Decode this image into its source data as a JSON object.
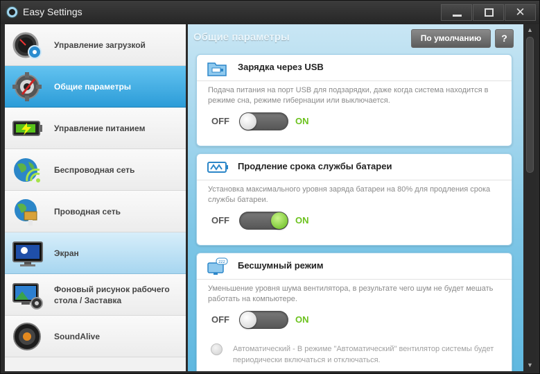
{
  "window": {
    "title": "Easy Settings",
    "minimize_icon": "minimize-icon",
    "maximize_icon": "maximize-icon",
    "close_glyph": "✕"
  },
  "sidebar": {
    "items": [
      {
        "label": "Управление загрузкой",
        "icon": "speedometer-icon",
        "state": "normal"
      },
      {
        "label": "Общие параметры",
        "icon": "gear-icon",
        "state": "active"
      },
      {
        "label": "Управление питанием",
        "icon": "battery-icon",
        "state": "normal"
      },
      {
        "label": "Беспроводная сеть",
        "icon": "wifi-globe-icon",
        "state": "normal"
      },
      {
        "label": "Проводная сеть",
        "icon": "wired-network-icon",
        "state": "normal"
      },
      {
        "label": "Экран",
        "icon": "display-icon",
        "state": "hover"
      },
      {
        "label": "Фоновый рисунок рабочего стола / Заставка",
        "icon": "wallpaper-icon",
        "state": "normal"
      },
      {
        "label": "SoundAlive",
        "icon": "speaker-icon",
        "state": "normal"
      }
    ]
  },
  "content": {
    "section_title": "Общие параметры",
    "default_button": "По умолчанию",
    "help_button": "?",
    "off_label": "OFF",
    "on_label": "ON",
    "cards": [
      {
        "title": "Зарядка через USB",
        "description": "Подача питания на порт USB для подзарядки, даже когда система находится в режиме сна, режиме гибернации или выключается.",
        "icon": "usb-folder-icon",
        "toggle": "off"
      },
      {
        "title": "Продление срока службы батареи",
        "description": "Установка максимального уровня заряда батареи на 80% для продления срока службы батареи.",
        "icon": "battery-life-icon",
        "toggle": "on"
      },
      {
        "title": "Бесшумный режим",
        "description": "Уменьшение уровня шума вентилятора, в результате чего шум не будет мешать работать на компьютере.",
        "icon": "silent-mode-icon",
        "toggle": "off",
        "radio_label": "Автоматический - В режиме \"Автоматический\" вентилятор системы будет периодически включаться и отключаться."
      }
    ]
  },
  "colors": {
    "accent_blue": "#2c9cd8",
    "on_green": "#6cc21e",
    "content_bg": "#7ec6e6"
  }
}
